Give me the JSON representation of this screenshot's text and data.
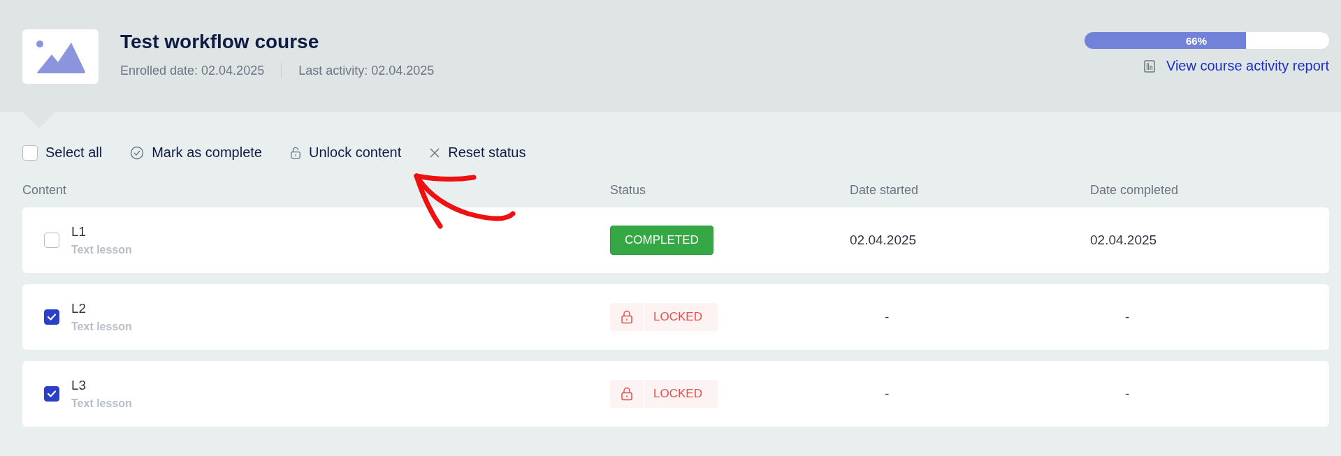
{
  "course": {
    "title": "Test workflow course",
    "enrolled": "Enrolled date: 02.04.2025",
    "last_activity": "Last activity: 02.04.2025"
  },
  "progress": {
    "level": 0.66,
    "label": "66%"
  },
  "report_link": "View course activity report",
  "toolbar": {
    "select_all": {
      "label": "Select all",
      "checked": false
    },
    "actions": [
      {
        "kind": "complete",
        "label": "Mark as complete"
      },
      {
        "kind": "unlock",
        "label": "Unlock content"
      },
      {
        "kind": "reset",
        "label": "Reset status"
      }
    ]
  },
  "table": {
    "columns": [
      "Content",
      "Status",
      "Date started",
      "Date completed"
    ],
    "rows": [
      {
        "name": "L1",
        "type": "Text lesson",
        "checked": false,
        "status": {
          "kind": "completed",
          "label": "COMPLETED"
        },
        "date_started": "02.04.2025",
        "date_completed": "02.04.2025"
      },
      {
        "name": "L2",
        "type": "Text lesson",
        "checked": true,
        "status": {
          "kind": "locked",
          "label": "LOCKED"
        },
        "date_started": "-",
        "date_completed": "-"
      },
      {
        "name": "L3",
        "type": "Text lesson",
        "checked": true,
        "status": {
          "kind": "locked",
          "label": "LOCKED"
        },
        "date_started": "-",
        "date_completed": "-"
      }
    ]
  }
}
